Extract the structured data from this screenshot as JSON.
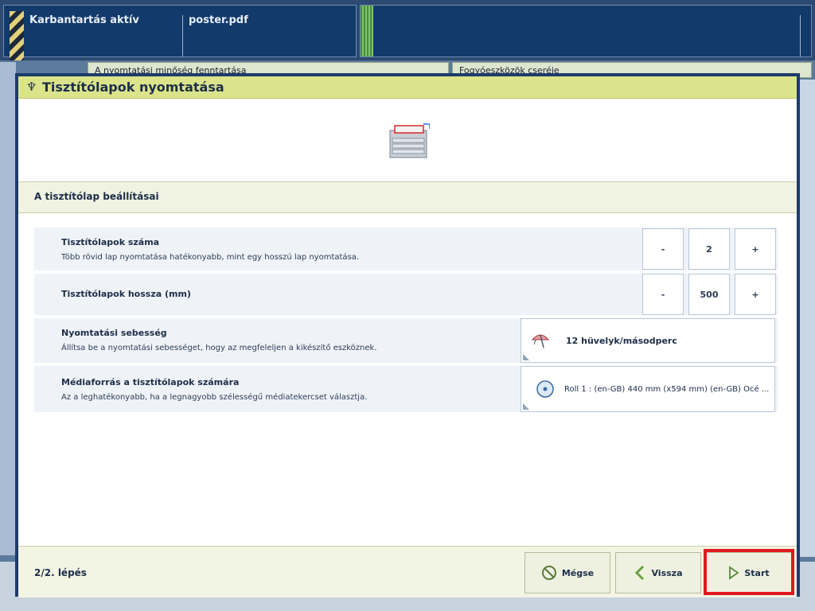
{
  "topbar": {
    "status": "Karbantartás aktív",
    "job": "poster.pdf"
  },
  "background": {
    "tab_left": "A nyomtatási minőség fenntartása",
    "tab_right": "Fogyóeszközök cseréje"
  },
  "dialog": {
    "title": "Tisztítólapok nyomtatása",
    "section_title": "A tisztítólap beállításai",
    "settings": {
      "count": {
        "title": "Tisztítólapok száma",
        "desc": "Több rövid lap nyomtatása hatékonyabb, mint egy hosszú lap nyomtatása.",
        "minus": "-",
        "value": "2",
        "plus": "+"
      },
      "length": {
        "title": "Tisztítólapok hossza (mm)",
        "minus": "-",
        "value": "500",
        "plus": "+"
      },
      "speed": {
        "title": "Nyomtatási sebesség",
        "desc": "Állítsa be a nyomtatási sebességet, hogy az megfeleljen a kikészítő eszköznek.",
        "value": "12 hüvelyk/másodperc"
      },
      "media": {
        "title": "Médiaforrás a tisztítólapok számára",
        "desc": "Az a leghatékonyabb, ha a legnagyobb szélességű médiatekercset választja.",
        "value": "Roll 1 : (en-GB) 440 mm (x594 mm) (en-GB) Océ ..."
      }
    },
    "footer": {
      "step": "2/2. lépés",
      "cancel": "Mégse",
      "back": "Vissza",
      "start": "Start"
    }
  },
  "colors": {
    "title_bar": "#dbe48a",
    "dialog_border": "#1d3c6c",
    "highlight": "#e0191e"
  }
}
